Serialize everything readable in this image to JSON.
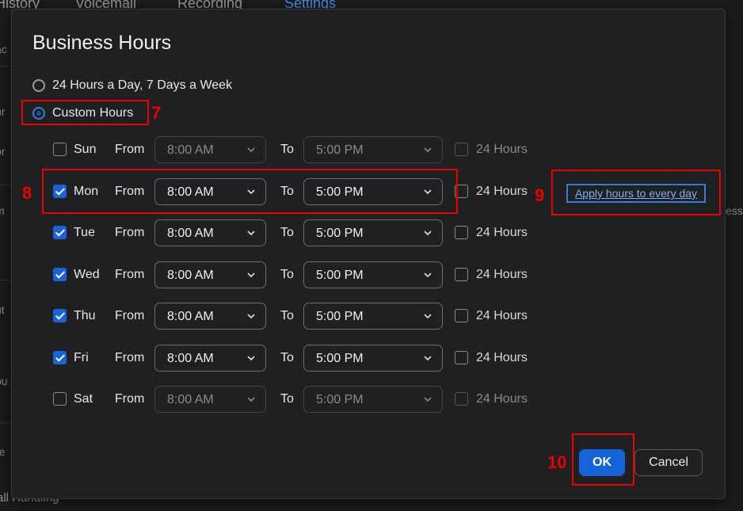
{
  "background": {
    "tabs": [
      {
        "label": "History",
        "active": false
      },
      {
        "label": "Voicemail",
        "active": false
      },
      {
        "label": "Recording",
        "active": false
      },
      {
        "label": "Settings",
        "active": true
      }
    ],
    "side_fragments": [
      "ac",
      "ur",
      "or",
      "m",
      "ut",
      "ou",
      "re"
    ],
    "bottom_text": "all Handling",
    "right_fragment": "ess"
  },
  "dialog": {
    "title": "Business Hours",
    "options": {
      "always_label": "24 Hours a Day, 7 Days a Week",
      "custom_label": "Custom Hours",
      "selected": "custom"
    },
    "labels": {
      "from": "From",
      "to": "To",
      "all_day": "24 Hours"
    },
    "days": [
      {
        "name": "Sun",
        "checked": false,
        "from": "8:00 AM",
        "to": "5:00 PM",
        "all_day": false
      },
      {
        "name": "Mon",
        "checked": true,
        "from": "8:00 AM",
        "to": "5:00 PM",
        "all_day": false
      },
      {
        "name": "Tue",
        "checked": true,
        "from": "8:00 AM",
        "to": "5:00 PM",
        "all_day": false
      },
      {
        "name": "Wed",
        "checked": true,
        "from": "8:00 AM",
        "to": "5:00 PM",
        "all_day": false
      },
      {
        "name": "Thu",
        "checked": true,
        "from": "8:00 AM",
        "to": "5:00 PM",
        "all_day": false
      },
      {
        "name": "Fri",
        "checked": true,
        "from": "8:00 AM",
        "to": "5:00 PM",
        "all_day": false
      },
      {
        "name": "Sat",
        "checked": false,
        "from": "8:00 AM",
        "to": "5:00 PM",
        "all_day": false
      }
    ],
    "apply_link": "Apply hours to every day",
    "ok_label": "OK",
    "cancel_label": "Cancel"
  },
  "annotations": [
    "7",
    "8",
    "9",
    "10"
  ],
  "colors": {
    "accent": "#1463d9",
    "annotation": "#ee0000",
    "link": "#7fb0ee"
  }
}
